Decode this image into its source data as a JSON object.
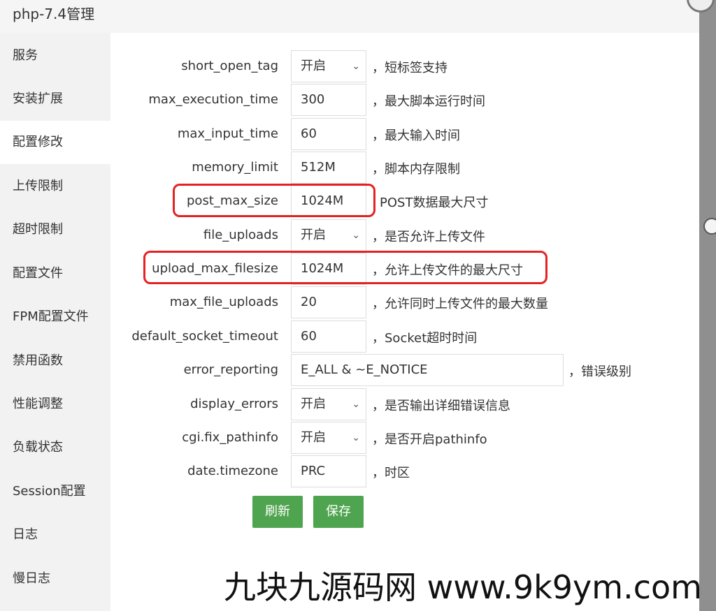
{
  "window": {
    "title": "php-7.4管理"
  },
  "sidebar": {
    "items": [
      {
        "label": "服务"
      },
      {
        "label": "安装扩展"
      },
      {
        "label": "配置修改",
        "active": true
      },
      {
        "label": "上传限制"
      },
      {
        "label": "超时限制"
      },
      {
        "label": "配置文件"
      },
      {
        "label": "FPM配置文件"
      },
      {
        "label": "禁用函数"
      },
      {
        "label": "性能调整"
      },
      {
        "label": "负载状态"
      },
      {
        "label": "Session配置"
      },
      {
        "label": "日志"
      },
      {
        "label": "慢日志"
      }
    ]
  },
  "settings": [
    {
      "name": "short_open_tag",
      "value": "开启",
      "type": "select",
      "desc": "，短标签支持"
    },
    {
      "name": "max_execution_time",
      "value": "300",
      "type": "input",
      "desc": "，最大脚本运行时间"
    },
    {
      "name": "max_input_time",
      "value": "60",
      "type": "input",
      "desc": "，最大输入时间"
    },
    {
      "name": "memory_limit",
      "value": "512M",
      "type": "input",
      "desc": "，脚本内存限制"
    },
    {
      "name": "post_max_size",
      "value": "1024M",
      "type": "input",
      "desc": "POST数据最大尺寸",
      "highlighted": true
    },
    {
      "name": "file_uploads",
      "value": "开启",
      "type": "select",
      "desc": "，是否允许上传文件"
    },
    {
      "name": "upload_max_filesize",
      "value": "1024M",
      "type": "input",
      "desc": "，允许上传文件的最大尺寸",
      "highlighted": true
    },
    {
      "name": "max_file_uploads",
      "value": "20",
      "type": "input",
      "desc": "，允许同时上传文件的最大数量"
    },
    {
      "name": "default_socket_timeout",
      "value": "60",
      "type": "input",
      "desc": "，Socket超时时间"
    },
    {
      "name": "error_reporting",
      "value": "E_ALL & ~E_NOTICE",
      "type": "input-long",
      "desc": "，错误级别"
    },
    {
      "name": "display_errors",
      "value": "开启",
      "type": "select",
      "desc": "，是否输出详细错误信息"
    },
    {
      "name": "cgi.fix_pathinfo",
      "value": "开启",
      "type": "select",
      "desc": "，是否开启pathinfo"
    },
    {
      "name": "date.timezone",
      "value": "PRC",
      "type": "input",
      "desc": "，时区"
    }
  ],
  "buttons": {
    "refresh": "刷新",
    "save": "保存"
  },
  "colors": {
    "highlight": "#e52222",
    "button": "#4fa44f",
    "sidebar_bg": "#f2f2f2"
  },
  "watermark": "九块九源码网 www.9k9ym.com"
}
